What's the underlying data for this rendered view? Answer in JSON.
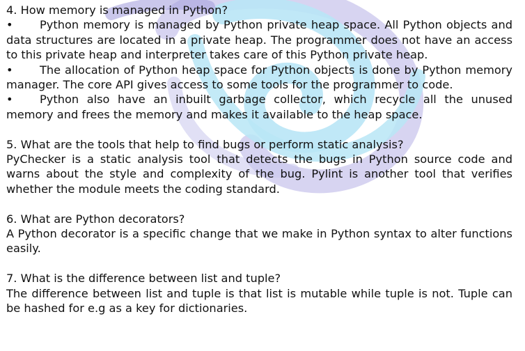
{
  "sections": [
    {
      "question": "4. How memory is managed in Python?",
      "bullets": [
        "Python memory is managed by Python private heap space. All Python objects and data structures are located in a private heap. The programmer does not have an access to this private heap and interpreter takes care of this Python private heap.",
        "The allocation of Python heap space for Python objects is done by Python memory manager. The core API gives access to some tools for the programmer to code.",
        "Python also have an inbuilt garbage collector, which recycle all the unused memory and frees the memory and makes it available to the heap space."
      ],
      "bullet_symbol": "•"
    },
    {
      "question": "5. What are the tools that help to find bugs or perform static analysis?",
      "answer": "PyChecker is a static analysis tool that detects the bugs in Python source code and warns about the style and complexity of the bug. Pylint is another tool that verifies whether the module meets the coding standard."
    },
    {
      "question": "6. What are Python decorators?",
      "answer": "A Python decorator is a specific change that we make in Python syntax to alter functions easily."
    },
    {
      "question": "7. What is the difference between list and tuple?",
      "answer": "The difference between list and tuple is that list is mutable while tuple is not. Tuple can be hashed for e.g as a key for dictionaries."
    }
  ],
  "watermark": {
    "colors": [
      "#b9e6f6",
      "#c9c6ec",
      "#a7a2de"
    ]
  }
}
